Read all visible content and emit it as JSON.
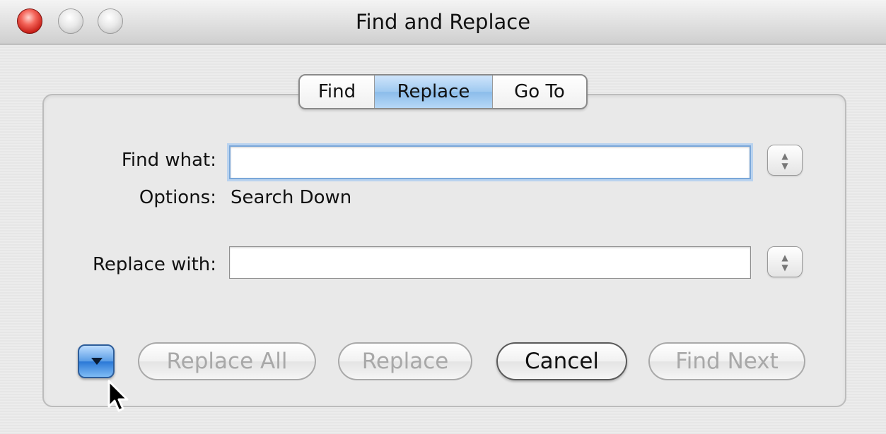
{
  "window": {
    "title": "Find and Replace"
  },
  "tabs": [
    {
      "label": "Find",
      "selected": false
    },
    {
      "label": "Replace",
      "selected": true
    },
    {
      "label": "Go To",
      "selected": false
    }
  ],
  "find": {
    "label": "Find what:",
    "value": ""
  },
  "options": {
    "label": "Options:",
    "value": "Search Down"
  },
  "replace": {
    "label": "Replace with:",
    "value": ""
  },
  "buttons": {
    "replace_all": "Replace All",
    "replace": "Replace",
    "cancel": "Cancel",
    "find_next": "Find Next"
  },
  "colors": {
    "selected_tab": "#9fc9f0",
    "close_button": "#d9302a",
    "disclosure_button": "#4a8ee0"
  },
  "icons": {
    "close": "close-icon",
    "minimize": "minimize-icon",
    "zoom": "zoom-icon",
    "disclosure": "chevron-down-icon",
    "stepper": "up-down-arrows-icon",
    "cursor": "mouse-pointer-icon"
  }
}
